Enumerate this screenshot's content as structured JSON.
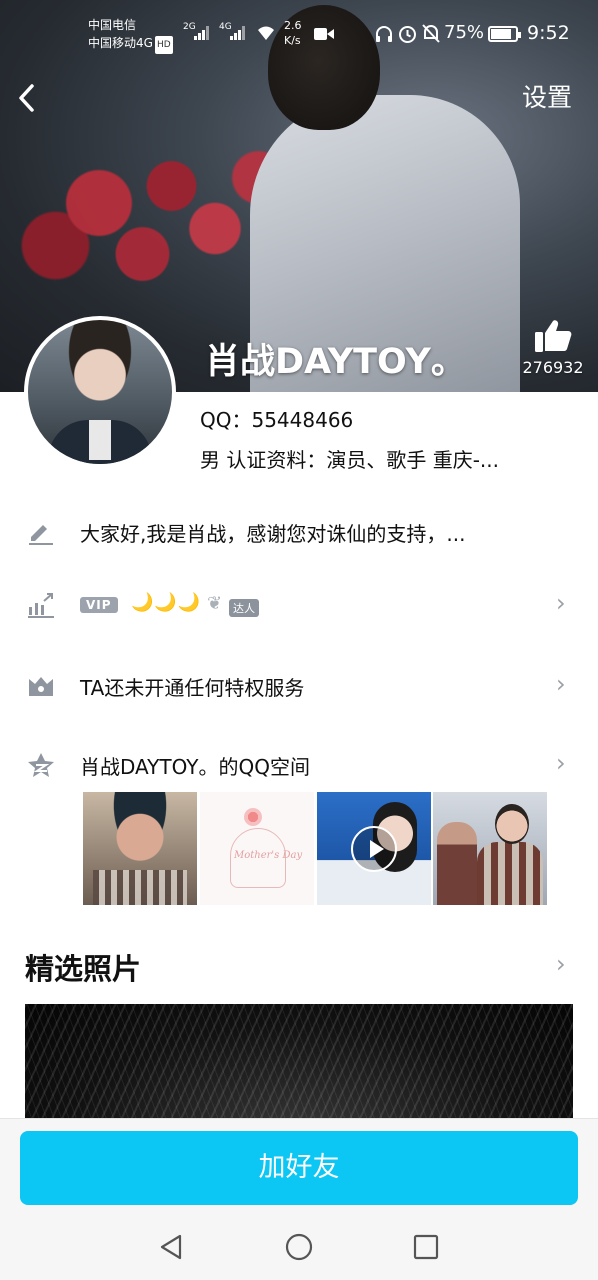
{
  "status_bar": {
    "carrier1": "中国电信",
    "carrier2": "中国移动4G",
    "hd": "HD",
    "sig1": "2G",
    "sig2": "4G",
    "net_speed": "2.6",
    "net_unit": "K/s",
    "battery_pct": "75%",
    "time": "9:52"
  },
  "header": {
    "back_icon": "chevron-left-icon",
    "settings_label": "设置"
  },
  "profile": {
    "nickname": "肖战DAYTOY。",
    "like_count": "276932",
    "qq": "QQ：55448466",
    "info": "男  认证资料：演员、歌手  重庆-..."
  },
  "rows": {
    "signature": "大家好,我是肖战，感谢您对诛仙的支持，...",
    "vip_label": "VIP",
    "daren_label": "达人",
    "privilege": "TA还未开通任何特权服务",
    "qzone": "肖战DAYTOY。的QQ空间"
  },
  "thumb_text": {
    "mothers_day": "Mother's Day"
  },
  "featured": {
    "title": "精选照片"
  },
  "footer": {
    "add_friend": "加好友"
  },
  "colors": {
    "accent": "#0cc6f3",
    "icon_gray": "#9aa0a6",
    "moon": "#f1c232"
  }
}
